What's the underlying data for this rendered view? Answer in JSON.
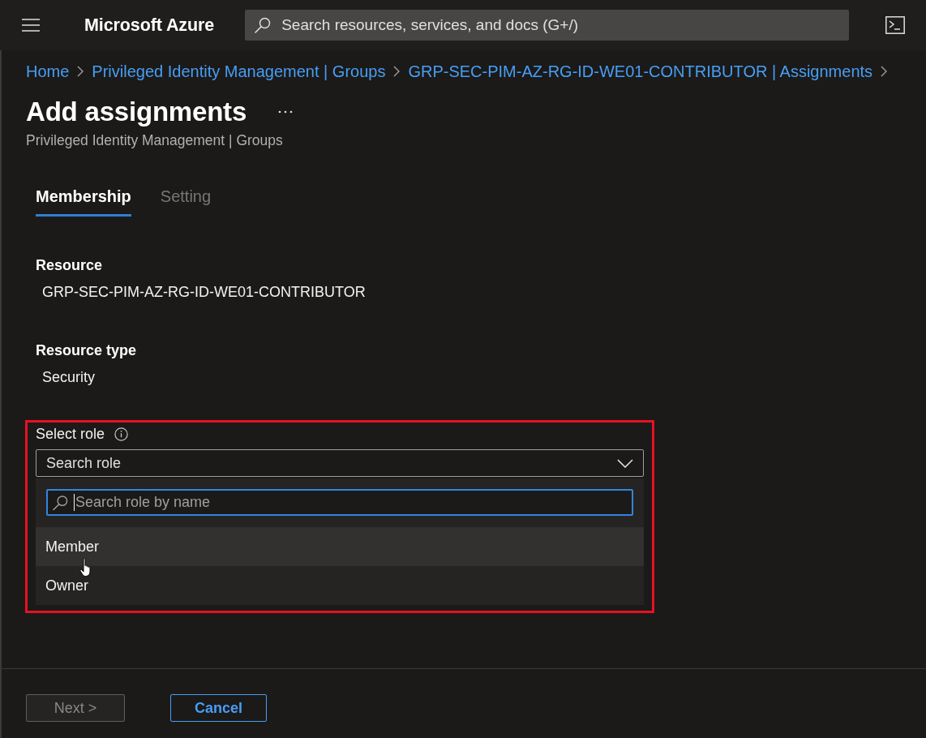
{
  "top_bar": {
    "title": "Microsoft Azure",
    "search": {
      "placeholder": "Search resources, services, and docs (G+/)"
    }
  },
  "breadcrumbs": [
    {
      "label": "Home"
    },
    {
      "label": "Privileged Identity Management | Groups"
    },
    {
      "label": "GRP-SEC-PIM-AZ-RG-ID-WE01-CONTRIBUTOR | Assignments"
    }
  ],
  "page": {
    "title": "Add assignments",
    "subtitle": "Privileged Identity Management | Groups"
  },
  "tabs": [
    {
      "label": "Membership",
      "selected": true
    },
    {
      "label": "Setting",
      "selected": false
    }
  ],
  "fields": [
    {
      "label": "Resource",
      "value": "GRP-SEC-PIM-AZ-RG-ID-WE01-CONTRIBUTOR"
    },
    {
      "label": "Resource type",
      "value": "Security"
    }
  ],
  "select_role": {
    "label": "Select role",
    "highlighted": true,
    "dropdown": {
      "text": "Search role",
      "expanded": true
    },
    "search": {
      "placeholder": "Search role by name",
      "focused": true
    },
    "options": [
      {
        "label": "Member",
        "hovered": true
      },
      {
        "label": "Owner",
        "hovered": false
      }
    ]
  },
  "footer": {
    "buttons": [
      {
        "label": "Next >",
        "kind": "secondary",
        "disabled": true
      },
      {
        "label": "Cancel",
        "kind": "outline",
        "disabled": false
      }
    ]
  }
}
